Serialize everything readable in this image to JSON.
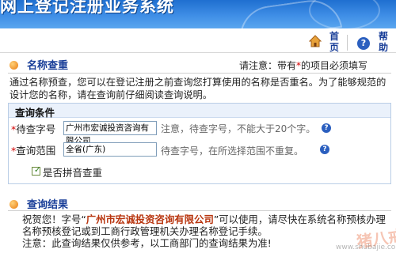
{
  "banner": {
    "title": "网上登记注册业务系统"
  },
  "toolbar": {
    "home_label": "首页",
    "help_label": "帮助",
    "help_icon_glyph": "?"
  },
  "name_check": {
    "title": "名称查重",
    "note_prefix": "请注意：带有",
    "note_star": "*",
    "note_suffix": "的项目必须填写",
    "intro": "通过名称预查，您可以在登记注册之前查询您打算使用的名称是否重名。为了能够规范的设计您的名称，请在查询前仔细阅读查询说明。"
  },
  "query": {
    "title": "查询条件",
    "name_field": {
      "star": "*",
      "label": "待查字号",
      "value": "广州市宏诚投资咨询有限公司",
      "hint": "注意，待查字号，不能大于20个字。"
    },
    "scope_field": {
      "star": "*",
      "label": "查询范围",
      "value": "全省(广东)",
      "hint": "待查字号，在所选择范围不重复。"
    },
    "pinyin": {
      "label": "是否拼音查重",
      "checked": true,
      "check_glyph": "✓"
    }
  },
  "result": {
    "title": "查询结果",
    "prefix": "祝贺您！字号“",
    "company": "广州市宏诚投资咨询有限公司",
    "suffix": "”可以使用，请尽快在系统名称预核办理名称预核登记或到工商行政管理机关办理名称登记手续。",
    "note": "注意：此查询结果仅供参考，以工商部门的查询结果为准!"
  },
  "watermark": {
    "text": "猪八戒",
    "url": "www.shubajie.com"
  },
  "colors": {
    "accent": "#1a3f99",
    "banner": "#2f7fdc",
    "required": "#d40000",
    "company": "#b8350f",
    "panel_border": "#b9cde6"
  }
}
